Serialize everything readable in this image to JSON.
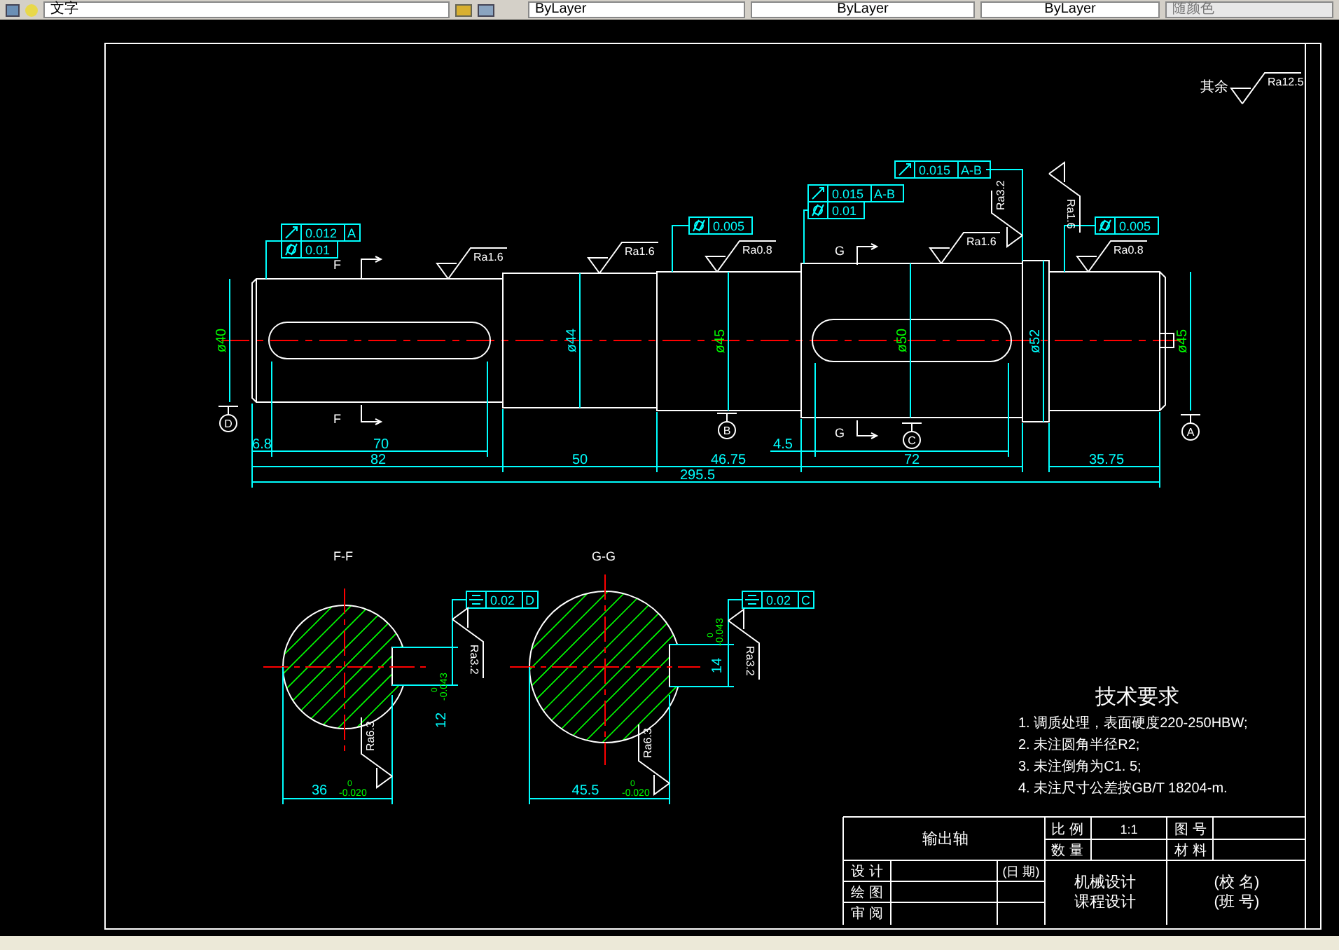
{
  "toolbar": {
    "text_style": "文字",
    "dropdowns": [
      "ByLayer",
      "ByLayer",
      "ByLayer"
    ],
    "plot_style": "随颜色"
  },
  "general_roughness": {
    "label": "其余",
    "value": "Ra12.5"
  },
  "main_view": {
    "tolerance_frames": [
      {
        "rows": [
          {
            "kind": "runout",
            "value": "0.012",
            "datum": "A"
          },
          {
            "kind": "cylindricity",
            "value": "0.01"
          }
        ]
      },
      {
        "rows": [
          {
            "kind": "cylindricity",
            "value": "0.005"
          }
        ]
      },
      {
        "rows": [
          {
            "kind": "runout",
            "value": "0.015",
            "datum": "A-B"
          },
          {
            "kind": "cylindricity",
            "value": "0.01"
          }
        ]
      },
      {
        "rows": [
          {
            "kind": "runout",
            "value": "0.015",
            "datum": "A-B"
          }
        ]
      },
      {
        "rows": [
          {
            "kind": "cylindricity",
            "value": "0.005"
          }
        ]
      }
    ],
    "roughness": [
      "Ra1.6",
      "Ra1.6",
      "Ra0.8",
      "Ra1.6",
      "Ra3.2",
      "Ra1.6",
      "Ra0.8"
    ],
    "section_marks": [
      "F",
      "F",
      "G",
      "G"
    ],
    "datums": [
      "D",
      "B",
      "C",
      "A"
    ],
    "diameters": [
      {
        "text": "ø40",
        "toleranced": true
      },
      {
        "text": "ø44",
        "toleranced": false
      },
      {
        "text": "ø45",
        "toleranced": true
      },
      {
        "text": "ø50",
        "toleranced": true
      },
      {
        "text": "ø52",
        "toleranced": false
      },
      {
        "text": "ø45",
        "toleranced": true
      }
    ],
    "lengths": [
      "6.8",
      "70",
      "4.5",
      "82",
      "50",
      "46.75",
      "72",
      "35.75",
      "295.5"
    ]
  },
  "sections": [
    {
      "title": "F-F",
      "tolerance_frame": {
        "rows": [
          {
            "kind": "symmetry",
            "value": "0.02",
            "datum": "D"
          }
        ]
      },
      "roughness": [
        "Ra3.2",
        "Ra6.3"
      ],
      "keyway_width": {
        "value": "12",
        "upper": "0",
        "lower": "-0.043"
      },
      "width": {
        "value": "36",
        "upper": "0",
        "lower": "-0.020"
      }
    },
    {
      "title": "G-G",
      "tolerance_frame": {
        "rows": [
          {
            "kind": "symmetry",
            "value": "0.02",
            "datum": "C"
          }
        ]
      },
      "roughness": [
        "Ra3.2",
        "Ra6.3"
      ],
      "keyway_width": {
        "value": "14",
        "upper": "0",
        "lower": "-0.043"
      },
      "width": {
        "value": "45.5",
        "upper": "0",
        "lower": "-0.020"
      }
    }
  ],
  "technical_requirements": {
    "title": "技术要求",
    "items": [
      "1. 调质处理，表面硬度220-250HBW;",
      "2. 未注圆角半径R2;",
      "3. 未注倒角为C1. 5;",
      "4. 未注尺寸公差按GB/T 18204-m."
    ]
  },
  "title_block": {
    "part_name": "输出轴",
    "scale_label": "比 例",
    "scale": "1:1",
    "drawing_no_label": "图 号",
    "quantity_label": "数 量",
    "material_label": "材 料",
    "designer_label": "设 计",
    "date_label": "(日 期)",
    "drafter_label": "绘 图",
    "reviewer_label": "审 阅",
    "course": [
      "机械设计",
      "课程设计"
    ],
    "school": [
      "(校 名)",
      "(班 号)"
    ]
  }
}
